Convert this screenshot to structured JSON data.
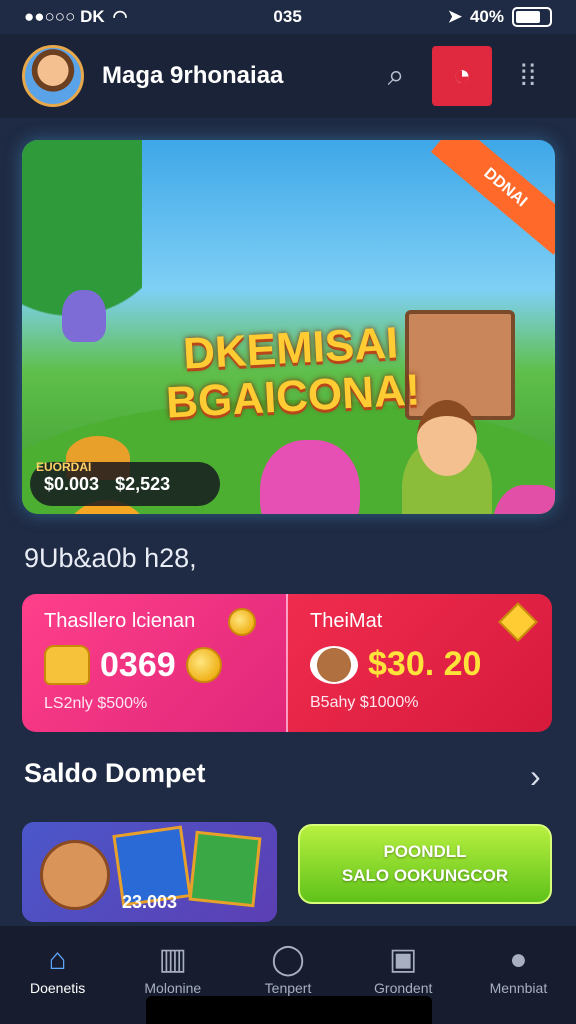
{
  "status_bar": {
    "carrier": "●●○○○ DK",
    "time": "035",
    "battery": "40%"
  },
  "header": {
    "title": "Maga 9rhonaiaa"
  },
  "banner": {
    "title_line1": "DKEMISAI",
    "title_line2": "BGAICONA!",
    "ribbon": "DDNAI",
    "prize_label": "EUORDAI",
    "prize_value1": "$0.003",
    "prize_value2": "$2,523"
  },
  "section_label": "9Ub&a0b h28,",
  "stats": {
    "left": {
      "title": "Thasllero lcienan",
      "value": "0369",
      "sub": "LS2nly $500%"
    },
    "right": {
      "title": "TheiMat",
      "value": "$30. 20",
      "sub": "B5ahy $1000%"
    }
  },
  "wallet": {
    "title": "Saldo Dompet",
    "card_value": "23.003",
    "action_top": "POONDLL",
    "action_bottom": "SALO OOKUNGCOR"
  },
  "bottom_nav": [
    {
      "label": "Doenetis",
      "icon": "home-icon"
    },
    {
      "label": "Molonine",
      "icon": "grid-icon"
    },
    {
      "label": "Tenpert",
      "icon": "check-circle-icon"
    },
    {
      "label": "Grondent",
      "icon": "wallet-icon"
    },
    {
      "label": "Mennbiat",
      "icon": "person-icon"
    }
  ],
  "colors": {
    "background": "#1f2a44",
    "accent_red": "#e0283e",
    "accent_pink": "#ff3f8a",
    "accent_green": "#7bd42a",
    "accent_blue": "#5fa9ff"
  }
}
